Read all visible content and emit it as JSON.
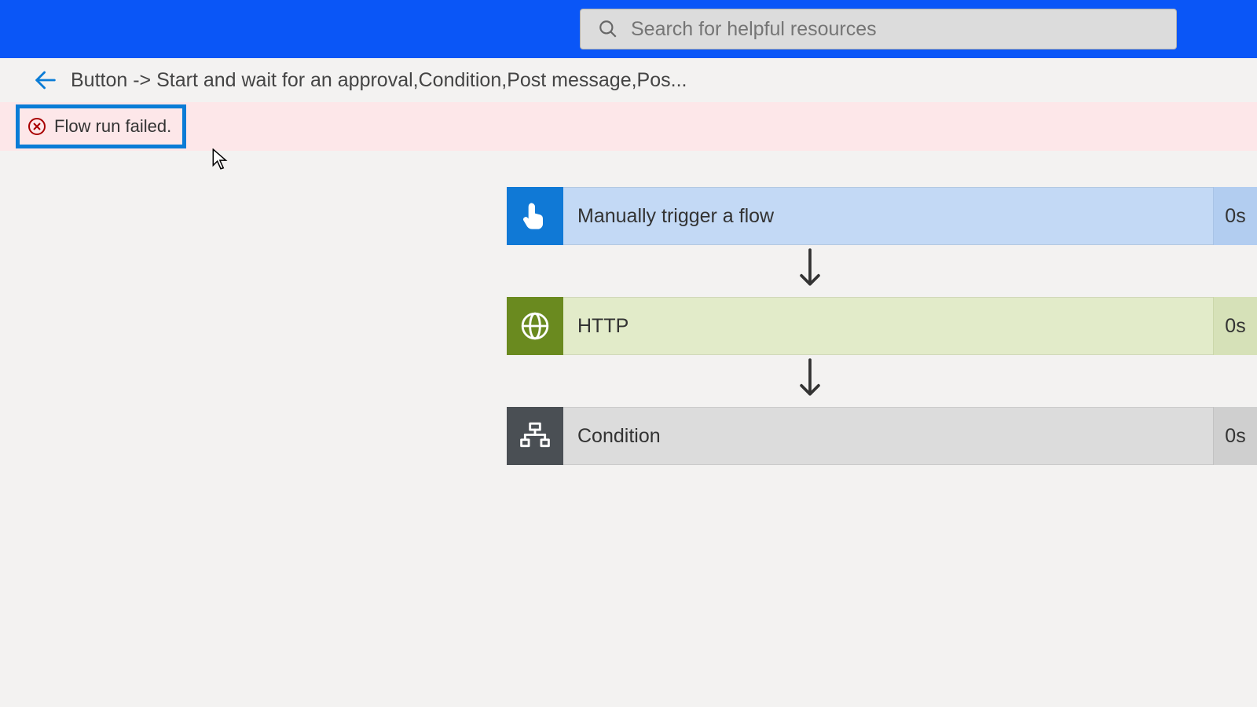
{
  "header": {
    "search_placeholder": "Search for helpful resources"
  },
  "breadcrumb": {
    "title": "Button -> Start and wait for an approval,Condition,Post message,Pos..."
  },
  "error": {
    "message": "Flow run failed."
  },
  "flow": {
    "steps": [
      {
        "label": "Manually trigger a flow",
        "duration": "0s",
        "icon": "touch"
      },
      {
        "label": "HTTP",
        "duration": "0s",
        "icon": "globe"
      },
      {
        "label": "Condition",
        "duration": "0s",
        "icon": "condition"
      }
    ]
  }
}
